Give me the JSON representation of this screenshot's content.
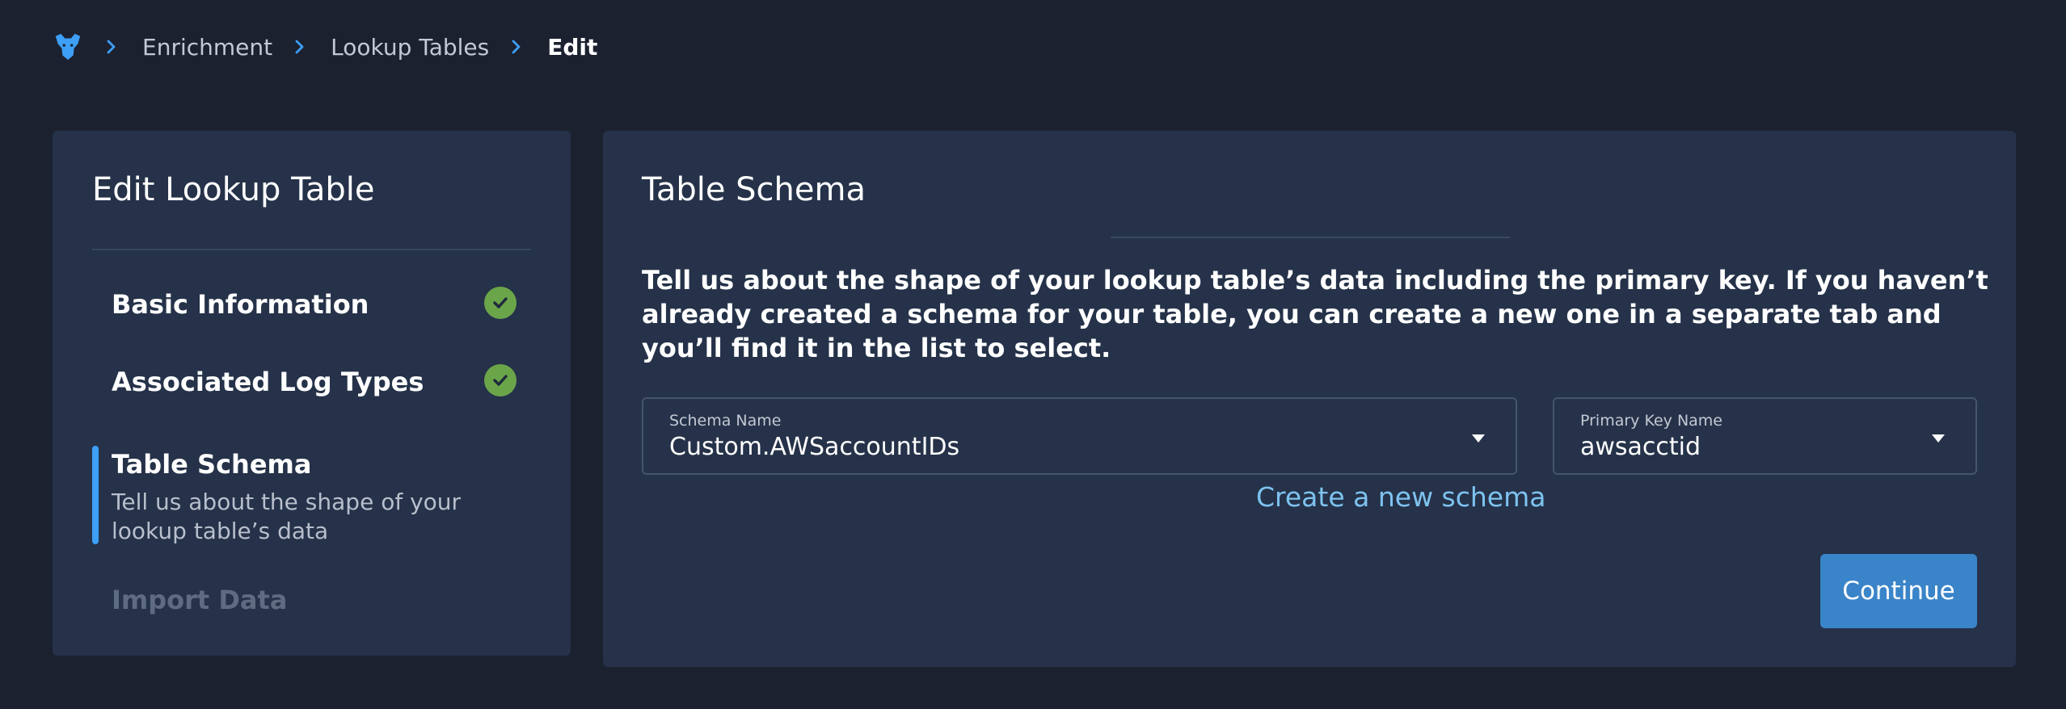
{
  "breadcrumb": {
    "logo_icon": "panther-logo-icon",
    "separator_icon": "chevron-right-icon",
    "items": [
      "Enrichment",
      "Lookup Tables"
    ],
    "current": "Edit"
  },
  "sidebar": {
    "title": "Edit Lookup Table",
    "steps": [
      {
        "label": "Basic Information",
        "status": "complete",
        "icon": "check-circle-icon"
      },
      {
        "label": "Associated Log Types",
        "status": "complete",
        "icon": "check-circle-icon"
      },
      {
        "label": "Table Schema",
        "status": "active",
        "description": "Tell us about the shape of your lookup table’s data"
      },
      {
        "label": "Import Data",
        "status": "pending"
      }
    ]
  },
  "main": {
    "title": "Table Schema",
    "description": "Tell us about the shape of your lookup table’s data including the primary key. If you haven’t already created a schema for your table, you can create a new one in a separate tab and you’ll find it in the list to select.",
    "schema_field": {
      "label": "Schema Name",
      "value": "Custom.AWSaccountIDs",
      "icon": "caret-down-icon"
    },
    "primary_key_field": {
      "label": "Primary Key Name",
      "value": "awsacctid",
      "icon": "caret-down-icon"
    },
    "create_link": "Create a new schema",
    "continue_label": "Continue"
  },
  "colors": {
    "background": "#1c2130",
    "panel": "#253249",
    "accent_blue": "#3d9ff5",
    "check_green": "#6ba54a",
    "button_blue": "#3a84c9",
    "link_blue": "#7ec3f0"
  }
}
